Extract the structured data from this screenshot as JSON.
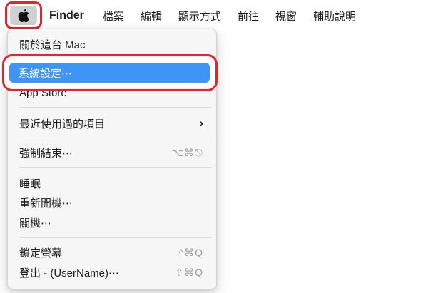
{
  "menubar": {
    "apple_icon": "apple-logo-icon",
    "items": [
      "Finder",
      "檔案",
      "編輯",
      "顯示方式",
      "前往",
      "視窗",
      "輔助說明"
    ]
  },
  "apple_menu": {
    "about": "關於這台 Mac",
    "settings": "系統設定⋯",
    "app_store": "App Store",
    "recent_items": "最近使用過的項目",
    "recent_items_arrow": "›",
    "force_quit": "強制結束⋯",
    "force_quit_shortcut": "⌥⌘⎋",
    "sleep": "睡眠",
    "restart": "重新開機⋯",
    "shutdown": "關機⋯",
    "lock_screen": "鎖定螢幕",
    "lock_screen_shortcut": "^⌘Q",
    "logout": "登出 - (UserName)⋯",
    "logout_shortcut": "⇧⌘Q"
  },
  "colors": {
    "highlight_ring": "#e5242b",
    "selection_blue": "#3f95f5"
  }
}
